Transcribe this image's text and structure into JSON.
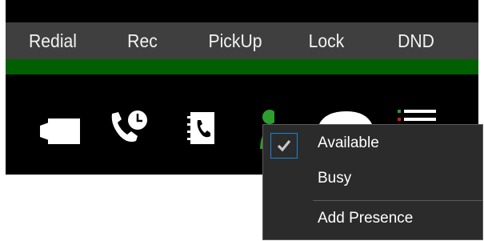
{
  "softkeys": [
    {
      "label": "Redial"
    },
    {
      "label": "Rec"
    },
    {
      "label": "PickUp"
    },
    {
      "label": "Lock"
    },
    {
      "label": "DND"
    }
  ],
  "toolbar_icons": [
    "video-camera-icon",
    "call-history-icon",
    "phonebook-icon",
    "presence-person-icon",
    "status-circle-icon",
    "list-icon"
  ],
  "presence_menu": {
    "items": [
      {
        "label": "Available",
        "checked": true
      },
      {
        "label": "Busy",
        "checked": false
      },
      {
        "label": "Add Presence",
        "checked": false
      }
    ]
  },
  "colors": {
    "softkey_bar": "#3f3f3f",
    "status_strip": "#006000",
    "presence_green": "#2e9e2e",
    "menu_background": "#2b2b2b",
    "check_accent": "#1c86d6"
  }
}
